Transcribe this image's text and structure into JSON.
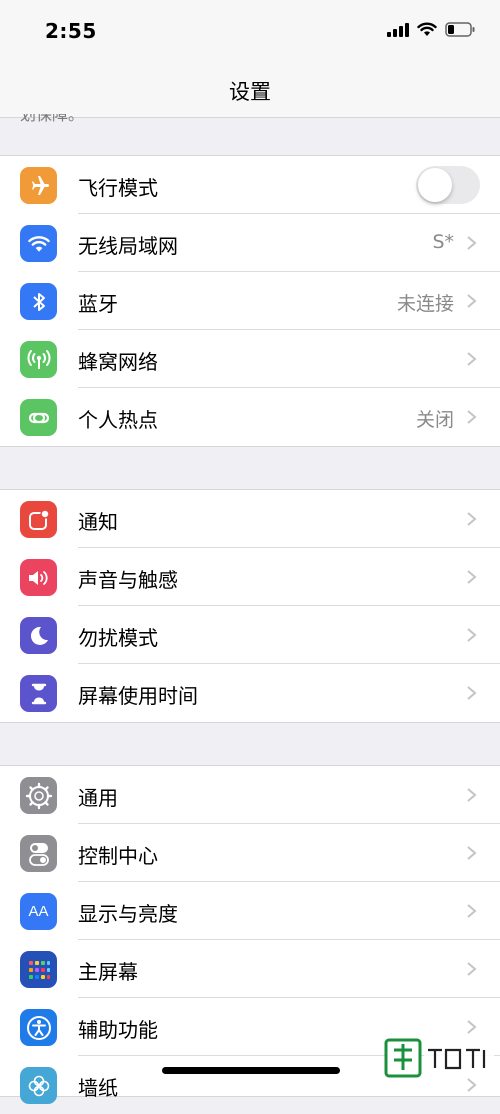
{
  "status_bar": {
    "time": "2:55",
    "icons": [
      "signal-icon",
      "wifi-icon",
      "battery-icon"
    ]
  },
  "nav": {
    "title": "设置"
  },
  "cut_text": "划保障。",
  "groups": [
    {
      "rows": [
        {
          "label": "飞行模式",
          "icon": "airplane-icon",
          "color": "#f19a38",
          "control": "toggle",
          "toggle_on": false
        },
        {
          "label": "无线局域网",
          "icon": "wifi-icon",
          "color": "#3478f6",
          "value": "S*"
        },
        {
          "label": "蓝牙",
          "icon": "bluetooth-icon",
          "color": "#3478f6",
          "value": "未连接"
        },
        {
          "label": "蜂窝网络",
          "icon": "cellular-icon",
          "color": "#5ac562"
        },
        {
          "label": "个人热点",
          "icon": "hotspot-icon",
          "color": "#5ac562",
          "value": "关闭"
        }
      ]
    },
    {
      "rows": [
        {
          "label": "通知",
          "icon": "notifications-icon",
          "color": "#e9483f"
        },
        {
          "label": "声音与触感",
          "icon": "sound-icon",
          "color": "#ea4460"
        },
        {
          "label": "勿扰模式",
          "icon": "moon-icon",
          "color": "#5b54cc"
        },
        {
          "label": "屏幕使用时间",
          "icon": "hourglass-icon",
          "color": "#5b54cc"
        }
      ]
    },
    {
      "rows": [
        {
          "label": "通用",
          "icon": "gear-icon",
          "color": "#8e8e93"
        },
        {
          "label": "控制中心",
          "icon": "control-center-icon",
          "color": "#8e8e93"
        },
        {
          "label": "显示与亮度",
          "icon": "display-icon",
          "color": "#3478f6",
          "glyph": "AA"
        },
        {
          "label": "主屏幕",
          "icon": "home-screen-icon",
          "color": "#2450b8"
        },
        {
          "label": "辅助功能",
          "icon": "accessibility-icon",
          "color": "#1f7be8"
        },
        {
          "label": "墙纸",
          "icon": "wallpaper-icon",
          "color": "#45a7d6"
        }
      ]
    }
  ]
}
